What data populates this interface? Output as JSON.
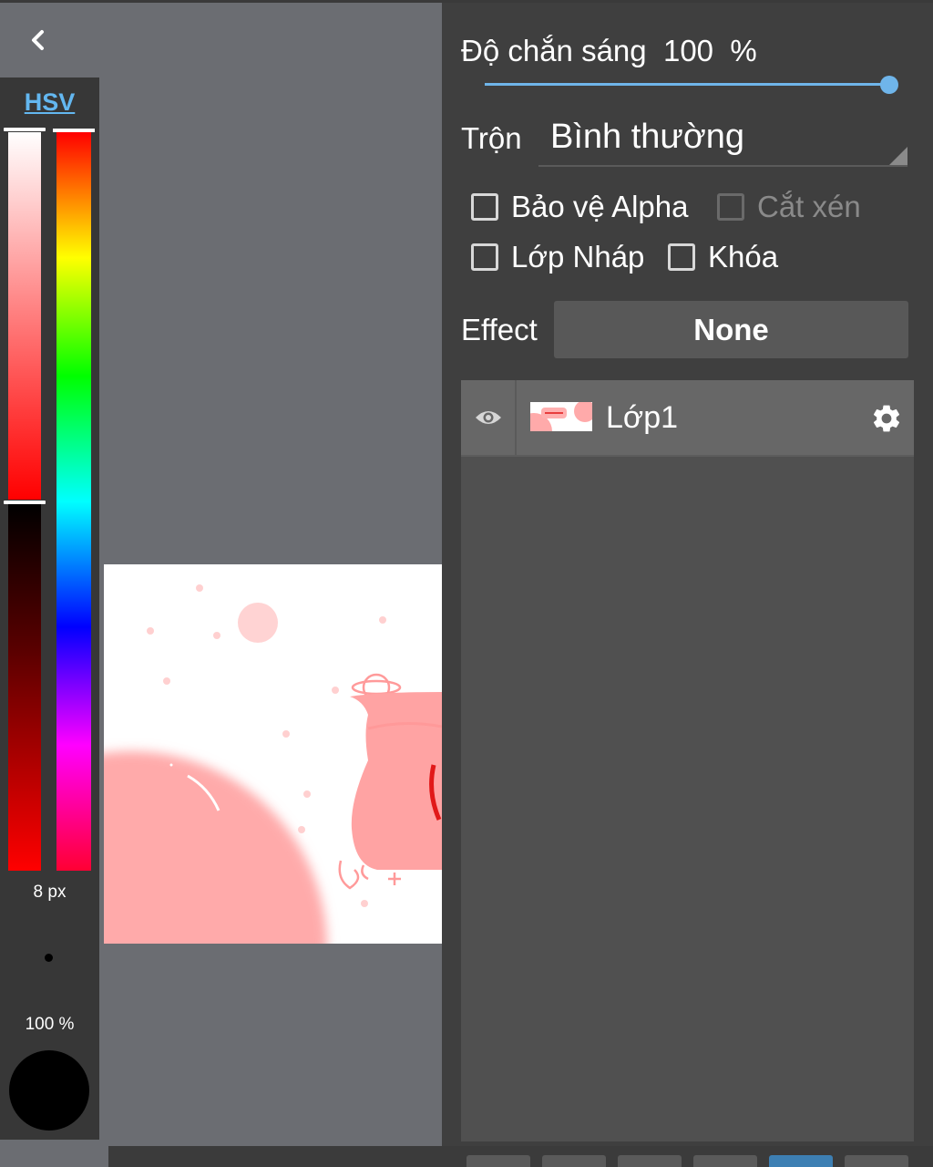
{
  "color_panel": {
    "mode_label": "HSV",
    "brush_size": "8 px",
    "brush_opacity": "100 %",
    "current_color": "#000000"
  },
  "layer_settings": {
    "opacity_label": "Độ chắn sáng  100  %",
    "opacity_value": 100,
    "blend_label": "Trộn",
    "blend_value": "Bình thường",
    "checkboxes": {
      "protect_alpha": "Bảo vệ Alpha",
      "clipping": "Cắt xén",
      "draft_layer": "Lớp Nháp",
      "lock": "Khóa"
    },
    "effect_label": "Effect",
    "effect_value": "None"
  },
  "layers": [
    {
      "name": "Lớp1",
      "visible": true
    }
  ],
  "colors": {
    "accent": "#6fb5ea",
    "panel_bg": "#3f3f3f",
    "canvas_pink": "#ffaaaa"
  },
  "icons": [
    "back-chevron-icon",
    "eye-icon",
    "gear-icon"
  ]
}
